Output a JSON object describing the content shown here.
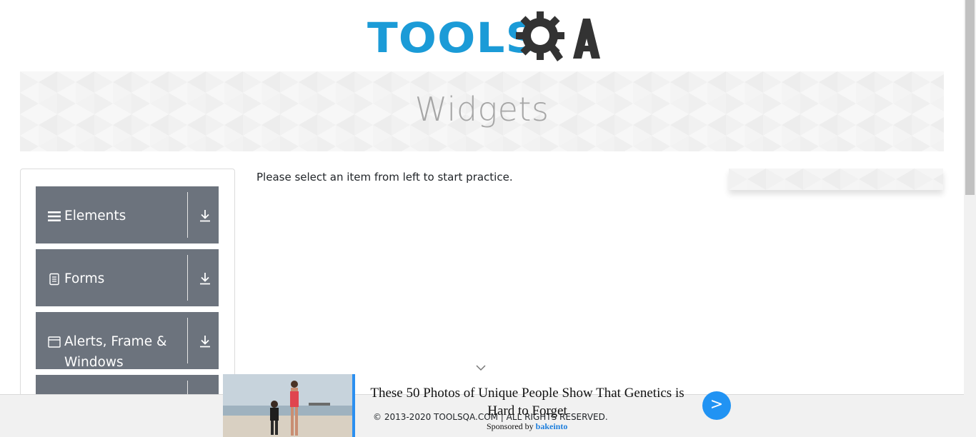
{
  "header": {
    "logo_text": "TOOLS",
    "logo_suffix": "QA",
    "logo_colors": {
      "tools": "#1b9bd7",
      "qa": "#333333"
    }
  },
  "banner": {
    "title": "Widgets"
  },
  "sidebar": {
    "groups": [
      {
        "label": "Elements",
        "icon": "hamburger-icon"
      },
      {
        "label": "Forms",
        "icon": "document-icon"
      },
      {
        "label": "Alerts, Frame & Windows",
        "icon": "window-icon"
      },
      {
        "label": "",
        "icon": ""
      }
    ],
    "group_color": "#6c737d",
    "collapse_icon": "download-arrow-icon"
  },
  "main": {
    "message": "Please select an item from left to start practice."
  },
  "footer": {
    "copyright": "© 2013-2020 TOOLSQA.COM | ALL RIGHTS RESERVED."
  },
  "ad": {
    "headline": "These 50 Photos of Unique People Show That Genetics is Hard to Forget",
    "sponsor_prefix": "Sponsored by",
    "sponsor_name": "bakeinto",
    "next_label": ">",
    "accent_color": "#2b8ff0"
  }
}
